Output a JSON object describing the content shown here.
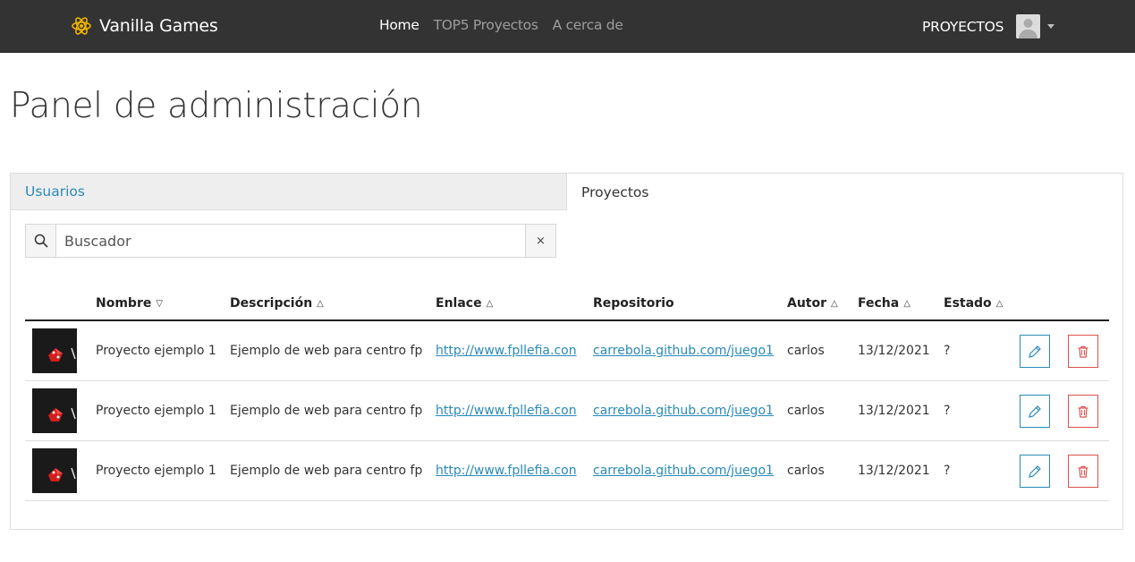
{
  "navbar": {
    "brand": "Vanilla Games",
    "links": [
      {
        "label": "Home",
        "active": true
      },
      {
        "label": "TOP5 Proyectos",
        "active": false
      },
      {
        "label": "A cerca de",
        "active": false
      }
    ],
    "projects_label": "PROYECTOS"
  },
  "page_title": "Panel de administración",
  "tabs": {
    "usuarios": "Usuarios",
    "proyectos": "Proyectos",
    "active": "Proyectos"
  },
  "search": {
    "placeholder": "Buscador",
    "clear_label": "×"
  },
  "table": {
    "columns": [
      {
        "label": "Nombre",
        "sort": "desc"
      },
      {
        "label": "Descripción",
        "sort": "asc"
      },
      {
        "label": "Enlace",
        "sort": "asc"
      },
      {
        "label": "Repositorio",
        "sort": null
      },
      {
        "label": "Autor",
        "sort": "asc"
      },
      {
        "label": "Fecha",
        "sort": "asc"
      },
      {
        "label": "Estado",
        "sort": "asc"
      }
    ],
    "sort_icons": {
      "asc": "△",
      "desc": "▽"
    },
    "rows": [
      {
        "nombre": "Proyecto ejemplo 1",
        "descripcion": "Ejemplo de web para centro fp",
        "enlace": "http://www.fpllefia.con",
        "repositorio": "carrebola.github.com/juego1",
        "autor": "carlos",
        "fecha": "13/12/2021",
        "estado": "?"
      },
      {
        "nombre": "Proyecto ejemplo 1",
        "descripcion": "Ejemplo de web para centro fp",
        "enlace": "http://www.fpllefia.con",
        "repositorio": "carrebola.github.com/juego1",
        "autor": "carlos",
        "fecha": "13/12/2021",
        "estado": "?"
      },
      {
        "nombre": "Proyecto ejemplo 1",
        "descripcion": "Ejemplo de web para centro fp",
        "enlace": "http://www.fpllefia.con",
        "repositorio": "carrebola.github.com/juego1",
        "autor": "carlos",
        "fecha": "13/12/2021",
        "estado": "?"
      }
    ]
  },
  "colors": {
    "navbar_bg": "#333333",
    "brand_icon": "#f0b400",
    "link_blue": "#2a8ab8",
    "danger_red": "#d9534f"
  },
  "icons": {
    "brand": "atom-icon",
    "search": "search-icon",
    "edit": "pencil-icon",
    "delete": "trash-icon",
    "avatar": "user-avatar-icon"
  }
}
